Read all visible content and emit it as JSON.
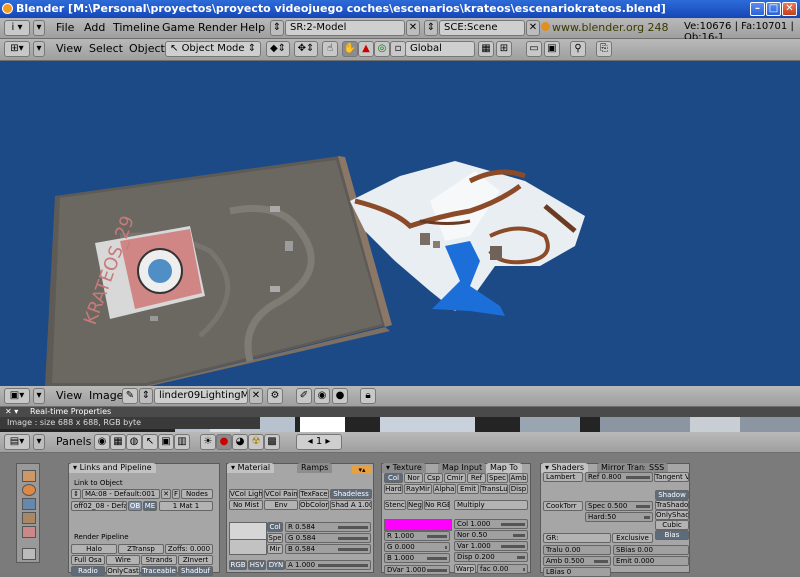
{
  "window": {
    "title": "Blender [M:\\Personal\\proyectos\\proyecto videojuego coches\\escenarios\\krateos\\escenariokrateos.blend]"
  },
  "info_header": {
    "menus": [
      "File",
      "Add",
      "Timeline",
      "Game",
      "Render",
      "Help"
    ],
    "screen": "SR:2-Model",
    "scene": "SCE:Scene",
    "url": "www.blender.org 248",
    "stats": "Ve:10676 | Fa:10701 | Ob:16-1"
  },
  "view3d_header": {
    "menus": [
      "View",
      "Select",
      "Object"
    ],
    "mode": "Object Mode",
    "orientation": "Global"
  },
  "image_header": {
    "menus": [
      "View",
      "Image"
    ],
    "image_name": "linder09LightingMap"
  },
  "strip": {
    "realtime_label": "Real-time Properties",
    "image_info": "Image : size 688 x 688, RGB byte"
  },
  "buttons_header": {
    "panels_label": "Panels",
    "frame": "1"
  },
  "scene_text": {
    "ground_letters": "KRATEOS_29"
  },
  "links_panel": {
    "tab": "Links and Pipeline",
    "link_to_object": "Link to Object",
    "ma_field": "MA:08 - Default:001",
    "f_btn": "F",
    "nodes_btn": "Nodes",
    "ob_field": "off02_08 - Defau",
    "ob_btn": "OB",
    "me_btn": "ME",
    "mat_count": "1 Mat 1",
    "render_pipeline": "Render Pipeline",
    "pipeline_buttons": [
      "Halo",
      "ZTransp",
      "Zoffs: 0.000",
      "Full Osa",
      "Wire",
      "Strands",
      "ZInvert",
      "Radio",
      "OnlyCast",
      "Traceable",
      "Shadbuf"
    ]
  },
  "material_panel": {
    "tabs": [
      "Material",
      "Ramps"
    ],
    "row1": [
      "VCol Light",
      "VCol Paint",
      "TexFace",
      "Shadeless"
    ],
    "row2": [
      "No Mist",
      "Env",
      "ObColor",
      "Shad A 1.00"
    ],
    "color_buttons": [
      "Col",
      "Spe",
      "Mir"
    ],
    "r": "R 0.584",
    "g": "G 0.584",
    "bval": "B 0.584",
    "modes": [
      "RGB",
      "HSV",
      "DYN"
    ],
    "alpha": "A 1.000"
  },
  "texture_panel": {
    "tabs": [
      "Texture",
      "Map Input",
      "Map To"
    ],
    "row1": [
      "Col",
      "Nor",
      "Csp",
      "Cmir",
      "Ref",
      "Spec",
      "Amb"
    ],
    "row2": [
      "Hard",
      "RayMir",
      "Alpha",
      "Emit",
      "TransLu",
      "Disp"
    ],
    "row3": [
      "Stencil",
      "Neg",
      "No RGB"
    ],
    "blend": "Multiply",
    "r": "R 1.000",
    "g": "G 0.000",
    "bval": "B 1.000",
    "dvar": "DVar 1.000",
    "col": "Col 1.000",
    "nor": "Nor 0.50",
    "var": "Var 1.000",
    "disp": "Disp 0.200",
    "warp": "Warp",
    "fac": "fac 0.00",
    "swatch_color": "#ff00ff"
  },
  "shaders_panel": {
    "tabs": [
      "Shaders",
      "Mirror Transp",
      "SSS"
    ],
    "diffuse": "Lambert",
    "ref": "Ref 0.800",
    "tangent": "Tangent V",
    "specular": "CookTorr",
    "spec": "Spec 0.500",
    "hard": "Hard:50",
    "right_buttons": [
      "Shadow",
      "TraShado",
      "OnlyShad",
      "Cubic",
      "Bias"
    ],
    "gr": "GR:",
    "exclusive": "Exclusive",
    "tralu": "Tralu 0.00",
    "sbias": "SBias 0.00",
    "amb": "Amb 0.500",
    "emit": "Emit 0.000",
    "lbias": "LBias 0"
  }
}
